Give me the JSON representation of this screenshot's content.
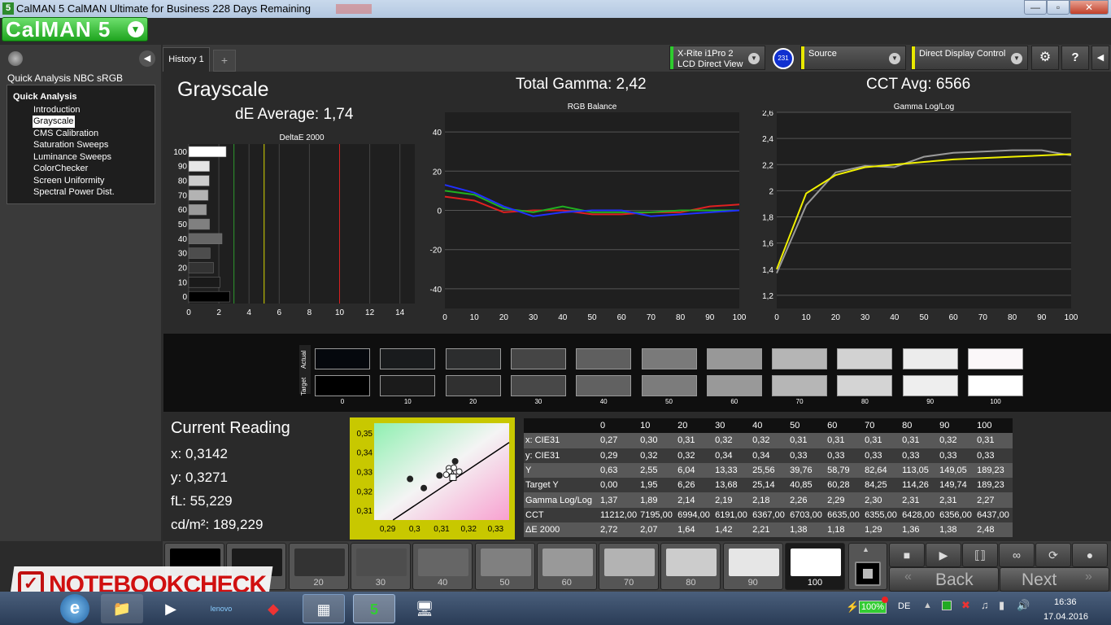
{
  "window": {
    "title": "CalMAN 5 CalMAN Ultimate for Business 228 Days Remaining",
    "minimize": "—",
    "maximize": "▫",
    "close": "✕"
  },
  "logo": {
    "text": "CalMAN 5"
  },
  "sidebar": {
    "workflow_title": "Quick Analysis NBC sRGB",
    "tree_root": "Quick Analysis",
    "items": [
      "Introduction",
      "Grayscale",
      "CMS Calibration",
      "Saturation Sweeps",
      "Luminance Sweeps",
      "ColorChecker",
      "Screen Uniformity",
      "Spectral Power Dist."
    ],
    "selected": "Grayscale"
  },
  "tabs": {
    "history": "History 1",
    "add": "+"
  },
  "devices": {
    "meter_line1": "X-Rite i1Pro 2",
    "meter_line2": "LCD Direct View",
    "meter_badge": "231",
    "source": "Source",
    "display": "Direct Display Control"
  },
  "header": {
    "page_title": "Grayscale",
    "total_gamma": "Total Gamma: 2,42",
    "cct_avg": "CCT Avg: 6566",
    "de_average": "dE Average: 1,74"
  },
  "charts": {
    "deltae": {
      "title": "DeltaE 2000",
      "y_ticks": [
        "100",
        "90",
        "80",
        "70",
        "60",
        "50",
        "40",
        "30",
        "20",
        "10",
        "0"
      ],
      "x_ticks": [
        "0",
        "2",
        "4",
        "6",
        "8",
        "10",
        "12",
        "14"
      ]
    },
    "rgb": {
      "title": "RGB Balance",
      "y_ticks": [
        "40",
        "20",
        "0",
        "-20",
        "-40"
      ],
      "x_ticks": [
        "0",
        "10",
        "20",
        "30",
        "40",
        "50",
        "60",
        "70",
        "80",
        "90",
        "100"
      ]
    },
    "gamma": {
      "title": "Gamma Log/Log",
      "y_ticks": [
        "2,6",
        "2,4",
        "2,2",
        "2",
        "1,8",
        "1,6",
        "1,4",
        "1,2"
      ],
      "x_ticks": [
        "0",
        "10",
        "20",
        "30",
        "40",
        "50",
        "60",
        "70",
        "80",
        "90",
        "100"
      ]
    }
  },
  "chart_data": [
    {
      "type": "bar",
      "title": "DeltaE 2000",
      "categories": [
        "0",
        "10",
        "20",
        "30",
        "40",
        "50",
        "60",
        "70",
        "80",
        "90",
        "100"
      ],
      "values": [
        2.72,
        2.07,
        1.64,
        1.42,
        2.21,
        1.38,
        1.18,
        1.29,
        1.36,
        1.38,
        2.48
      ],
      "xlim": [
        0,
        15
      ],
      "reference_lines": [
        {
          "value": 3,
          "color": "#2e9a2e"
        },
        {
          "value": 5,
          "color": "#d8d800"
        },
        {
          "value": 10,
          "color": "#d82020"
        }
      ]
    },
    {
      "type": "line",
      "title": "RGB Balance",
      "x": [
        0,
        10,
        20,
        30,
        40,
        50,
        60,
        70,
        80,
        90,
        100
      ],
      "ylim": [
        -50,
        50
      ],
      "series": [
        {
          "color": "#e02020",
          "values": [
            7,
            5,
            -1,
            0,
            0,
            -2,
            -2,
            -1,
            -1,
            2,
            3
          ]
        },
        {
          "color": "#20b020",
          "values": [
            10,
            8,
            1,
            -1,
            2,
            -1,
            -1,
            -1,
            0,
            0,
            0
          ]
        },
        {
          "color": "#2030ff",
          "values": [
            13,
            9,
            2,
            -3,
            -1,
            0,
            0,
            -3,
            -2,
            -1,
            0
          ]
        }
      ]
    },
    {
      "type": "line",
      "title": "Gamma Log/Log",
      "x": [
        0,
        10,
        20,
        30,
        40,
        50,
        60,
        70,
        80,
        90,
        100
      ],
      "ylim": [
        1.1,
        2.6
      ],
      "series": [
        {
          "color": "#999999",
          "values": [
            1.37,
            1.89,
            2.14,
            2.19,
            2.18,
            2.26,
            2.29,
            2.3,
            2.31,
            2.31,
            2.27
          ]
        },
        {
          "color": "#f0f000",
          "values": [
            1.4,
            1.98,
            2.12,
            2.18,
            2.2,
            2.22,
            2.24,
            2.25,
            2.26,
            2.27,
            2.28
          ]
        }
      ]
    },
    {
      "type": "scatter",
      "title": "CIE xy",
      "x_ticks": [
        "0,29",
        "0,3",
        "0,31",
        "0,32",
        "0,33"
      ],
      "y_ticks": [
        "0,35",
        "0,34",
        "0,33",
        "0,32",
        "0,31"
      ],
      "xlim": [
        0.285,
        0.335
      ],
      "ylim": [
        0.305,
        0.355
      ],
      "points": [
        [
          0.27,
          0.29
        ],
        [
          0.3,
          0.32
        ],
        [
          0.31,
          0.32
        ],
        [
          0.32,
          0.34
        ],
        [
          0.32,
          0.34
        ],
        [
          0.31,
          0.33
        ],
        [
          0.31,
          0.33
        ],
        [
          0.31,
          0.33
        ],
        [
          0.31,
          0.33
        ],
        [
          0.32,
          0.33
        ],
        [
          0.31,
          0.33
        ]
      ]
    }
  ],
  "swatches": {
    "actual_label": "Actual",
    "target_label": "Target",
    "labels": [
      "0",
      "10",
      "20",
      "30",
      "40",
      "50",
      "60",
      "70",
      "80",
      "90",
      "100"
    ],
    "actual_colors": [
      "#05080d",
      "#191b1d",
      "#2c2d2e",
      "#454545",
      "#5f5f5f",
      "#7a7a7a",
      "#989898",
      "#b5b5b5",
      "#d2d2d2",
      "#ececec",
      "#fbf7f9"
    ],
    "target_colors": [
      "#000000",
      "#1b1b1b",
      "#303030",
      "#484848",
      "#616161",
      "#7c7c7c",
      "#999999",
      "#b6b6b6",
      "#d4d4d4",
      "#eeeeee",
      "#ffffff"
    ]
  },
  "reading": {
    "title": "Current Reading",
    "x": "x: 0,3142",
    "y": "y: 0,3271",
    "fl": "fL: 55,229",
    "cdm2": "cd/m²: 189,229"
  },
  "table": {
    "headers": [
      "",
      "0",
      "10",
      "20",
      "30",
      "40",
      "50",
      "60",
      "70",
      "80",
      "90",
      "100"
    ],
    "rows": [
      [
        "x: CIE31",
        "0,27",
        "0,30",
        "0,31",
        "0,32",
        "0,32",
        "0,31",
        "0,31",
        "0,31",
        "0,31",
        "0,32",
        "0,31"
      ],
      [
        "y: CIE31",
        "0,29",
        "0,32",
        "0,32",
        "0,34",
        "0,34",
        "0,33",
        "0,33",
        "0,33",
        "0,33",
        "0,33",
        "0,33"
      ],
      [
        "Y",
        "0,63",
        "2,55",
        "6,04",
        "13,33",
        "25,56",
        "39,76",
        "58,79",
        "82,64",
        "113,05",
        "149,05",
        "189,23"
      ],
      [
        "Target Y",
        "0,00",
        "1,95",
        "6,26",
        "13,68",
        "25,14",
        "40,85",
        "60,28",
        "84,25",
        "114,26",
        "149,74",
        "189,23"
      ],
      [
        "Gamma Log/Log",
        "1,37",
        "1,89",
        "2,14",
        "2,19",
        "2,18",
        "2,26",
        "2,29",
        "2,30",
        "2,31",
        "2,31",
        "2,27"
      ],
      [
        "CCT",
        "11212,00",
        "7195,00",
        "6994,00",
        "6191,00",
        "6367,00",
        "6703,00",
        "6635,00",
        "6355,00",
        "6428,00",
        "6356,00",
        "6437,00"
      ],
      [
        "ΔE 2000",
        "2,72",
        "2,07",
        "1,64",
        "1,42",
        "2,21",
        "1,38",
        "1,18",
        "1,29",
        "1,36",
        "1,38",
        "2,48"
      ]
    ]
  },
  "patches": {
    "labels": [
      "",
      "",
      "20",
      "30",
      "40",
      "50",
      "60",
      "70",
      "80",
      "90",
      "100"
    ],
    "colors": [
      "#000000",
      "#1a1a1a",
      "#333333",
      "#4d4d4d",
      "#666666",
      "#808080",
      "#999999",
      "#b3b3b3",
      "#cccccc",
      "#e6e6e6",
      "#ffffff"
    ],
    "active": "100"
  },
  "nav": {
    "back": "Back",
    "next": "Next"
  },
  "watermark": {
    "text": "NOTEBOOKCHECK"
  },
  "taskbar": {
    "lang": "DE",
    "battery": "100%",
    "time": "16:36",
    "date": "17.04.2016"
  }
}
